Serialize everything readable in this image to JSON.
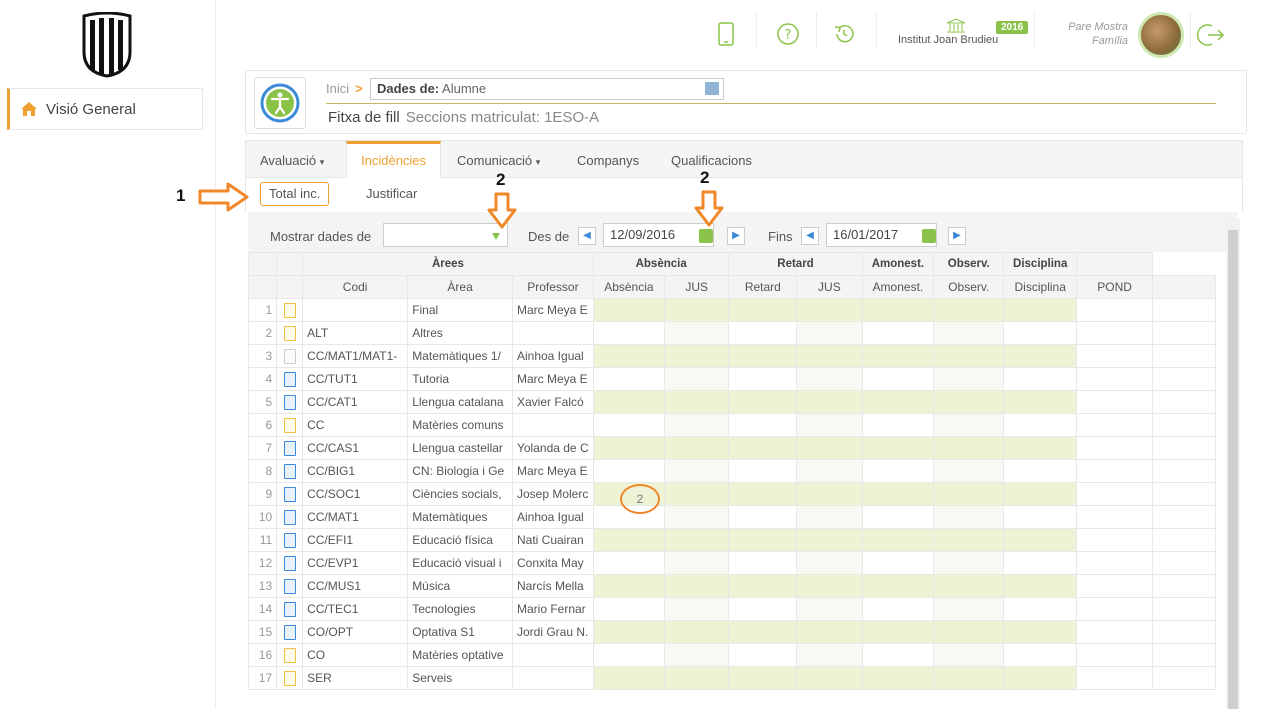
{
  "sidebar": {
    "nav_label": "Visió General"
  },
  "topbar": {
    "school_name": "Institut Joan Brudieu",
    "year_badge": "2016",
    "user_name": "Pare Mostra",
    "user_role": "Família"
  },
  "header": {
    "breadcrumb_home": "Inici",
    "dades_label": "Dades de:",
    "dades_value": "Alumne",
    "title": "Fitxa de fill",
    "subtitle": "Seccions matriculat: 1ESO-A"
  },
  "tabs": [
    {
      "label": "Avaluació",
      "caret": "▾"
    },
    {
      "label": "Incidències"
    },
    {
      "label": "Comunicació",
      "caret": "▾"
    },
    {
      "label": "Companys"
    },
    {
      "label": "Qualificacions"
    }
  ],
  "subtabs": {
    "total": "Total inc.",
    "justificar": "Justificar"
  },
  "filters": {
    "mostrar_label": "Mostrar dades de",
    "des_label": "Des de",
    "des_value": "12/09/2016",
    "fins_label": "Fins",
    "fins_value": "16/01/2017"
  },
  "annotations": {
    "a1": "1",
    "a2": "2",
    "a3": "2"
  },
  "table": {
    "group_headers": {
      "arees": "Àrees",
      "absencia": "Absència",
      "retard": "Retard",
      "amonest": "Amonest.",
      "observ": "Observ.",
      "disciplina": "Disciplina"
    },
    "columns": {
      "codi": "Codi",
      "area": "Àrea",
      "professor": "Professor",
      "absencia": "Absència",
      "jus1": "JUS",
      "retard": "Retard",
      "jus2": "JUS",
      "amonest": "Amonest.",
      "observ": "Observ.",
      "disciplina": "Disciplina",
      "pond": "POND"
    },
    "rows": [
      {
        "n": "1",
        "icon": "y",
        "codi": "",
        "area": "Final",
        "prof": "Marc Meya E"
      },
      {
        "n": "2",
        "icon": "y",
        "codi": "ALT",
        "area": "Altres",
        "prof": ""
      },
      {
        "n": "3",
        "icon": "gr",
        "codi": "CC/MAT1/MAT1-",
        "area": "Matemàtiques 1/",
        "prof": "Ainhoa Igual"
      },
      {
        "n": "4",
        "icon": "b",
        "codi": "CC/TUT1",
        "area": "Tutoria",
        "prof": "Marc Meya E"
      },
      {
        "n": "5",
        "icon": "b",
        "codi": "CC/CAT1",
        "area": "Llengua catalana",
        "prof": "Xavier Falcó"
      },
      {
        "n": "6",
        "icon": "y",
        "codi": "CC",
        "area": "Matèries comuns",
        "prof": ""
      },
      {
        "n": "7",
        "icon": "b",
        "codi": "CC/CAS1",
        "area": "Llengua castellar",
        "prof": "Yolanda de C"
      },
      {
        "n": "8",
        "icon": "b",
        "codi": "CC/BIG1",
        "area": "CN: Biologia i Ge",
        "prof": "Marc Meya E"
      },
      {
        "n": "9",
        "icon": "b",
        "codi": "CC/SOC1",
        "area": "Ciències socials,",
        "prof": "Josep Molerc"
      },
      {
        "n": "10",
        "icon": "b",
        "codi": "CC/MAT1",
        "area": "Matemàtiques",
        "prof": "Ainhoa Igual"
      },
      {
        "n": "11",
        "icon": "b",
        "codi": "CC/EFI1",
        "area": "Educació física",
        "prof": "Nati Cuairan"
      },
      {
        "n": "12",
        "icon": "b",
        "codi": "CC/EVP1",
        "area": "Educació visual i",
        "prof": "Conxita May"
      },
      {
        "n": "13",
        "icon": "b",
        "codi": "CC/MUS1",
        "area": "Música",
        "prof": "Narcís Mella"
      },
      {
        "n": "14",
        "icon": "b",
        "codi": "CC/TEC1",
        "area": "Tecnologies",
        "prof": "Mario Fernar"
      },
      {
        "n": "15",
        "icon": "b",
        "codi": "CO/OPT",
        "area": "Optativa S1",
        "prof": "Jordi Grau N."
      },
      {
        "n": "16",
        "icon": "y",
        "codi": "CO",
        "area": "Matèries optative",
        "prof": ""
      },
      {
        "n": "17",
        "icon": "y",
        "codi": "SER",
        "area": "Serveis",
        "prof": ""
      }
    ],
    "highlight_value": "2"
  }
}
